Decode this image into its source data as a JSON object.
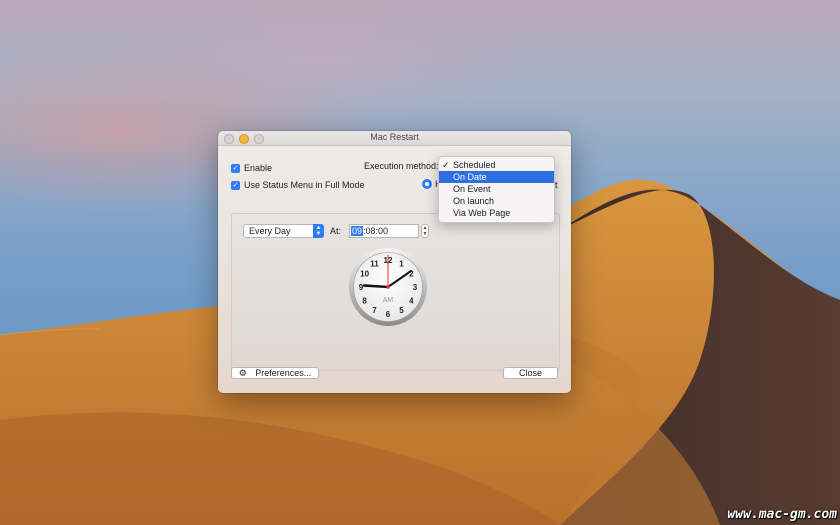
{
  "window": {
    "title": "Mac Restart"
  },
  "options": {
    "enable_label": "Enable",
    "status_menu_label": "Use Status Menu in Full Mode",
    "execution_method_label": "Execution method:",
    "radio_label_partial": "H",
    "trailing_partial": "rt"
  },
  "schedule": {
    "repeat_value": "Every Day",
    "at_label": "At:",
    "time_hours": "09",
    "time_rest": ":08:00"
  },
  "clock": {
    "numerals": [
      "12",
      "1",
      "2",
      "3",
      "4",
      "5",
      "6",
      "7",
      "8",
      "9",
      "10",
      "11"
    ],
    "meridiem": "AM"
  },
  "buttons": {
    "preferences_label": "Preferences...",
    "close_label": "Close"
  },
  "menu": {
    "items": [
      {
        "label": "Scheduled",
        "checked": true
      },
      {
        "label": "On Date",
        "selected": true
      },
      {
        "label": "On Event"
      },
      {
        "label": "On launch"
      },
      {
        "label": "Via Web Page"
      }
    ]
  },
  "watermark": "www.mac-gm.com",
  "colors": {
    "accent": "#2f7cf6",
    "menu_highlight": "#2d6fe0",
    "second_hand": "#e0322a"
  }
}
